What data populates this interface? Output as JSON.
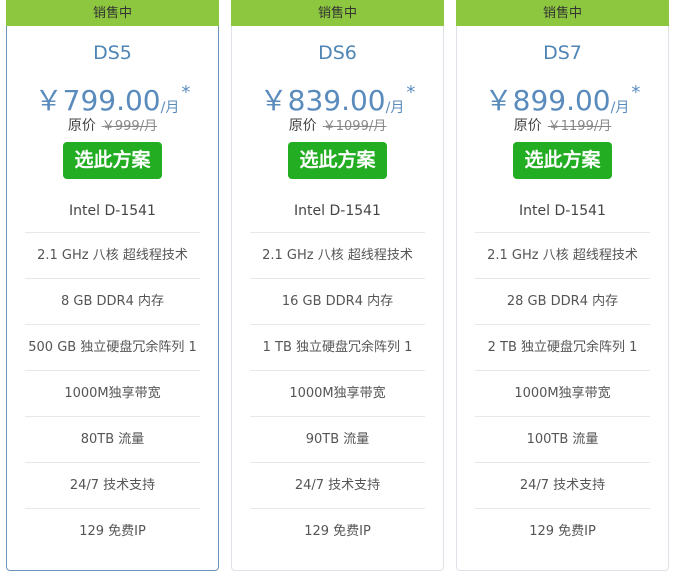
{
  "plans": [
    {
      "status": "销售中",
      "name": "DS5",
      "price": "￥799.00",
      "unit": "/月",
      "star": "*",
      "orig_label": "原价",
      "orig_price": "￥999/月",
      "button": "选此方案",
      "features": [
        "Intel D-1541",
        "2.1 GHz 八核 超线程技术",
        "8 GB DDR4 内存",
        "500 GB 独立硬盘冗余阵列 1",
        "1000M独享带宽",
        "80TB 流量",
        "24/7 技术支持",
        "129 免费IP"
      ]
    },
    {
      "status": "销售中",
      "name": "DS6",
      "price": "￥839.00",
      "unit": "/月",
      "star": "*",
      "orig_label": "原价",
      "orig_price": "￥1099/月",
      "button": "选此方案",
      "features": [
        "Intel D-1541",
        "2.1 GHz 八核 超线程技术",
        "16 GB DDR4 内存",
        "1 TB 独立硬盘冗余阵列 1",
        "1000M独享带宽",
        "90TB 流量",
        "24/7 技术支持",
        "129 免费IP"
      ]
    },
    {
      "status": "销售中",
      "name": "DS7",
      "price": "￥899.00",
      "unit": "/月",
      "star": "*",
      "orig_label": "原价",
      "orig_price": "￥1199/月",
      "button": "选此方案",
      "features": [
        "Intel D-1541",
        "2.1 GHz 八核 超线程技术",
        "28 GB DDR4 内存",
        "2 TB 独立硬盘冗余阵列 1",
        "1000M独享带宽",
        "100TB 流量",
        "24/7 技术支持",
        "129 免费IP"
      ]
    }
  ],
  "colors": {
    "status_bg": "#8dc63f",
    "accent_blue": "#4f85b5",
    "button_green": "#22ad22",
    "selected_border": "#6f93b8"
  }
}
